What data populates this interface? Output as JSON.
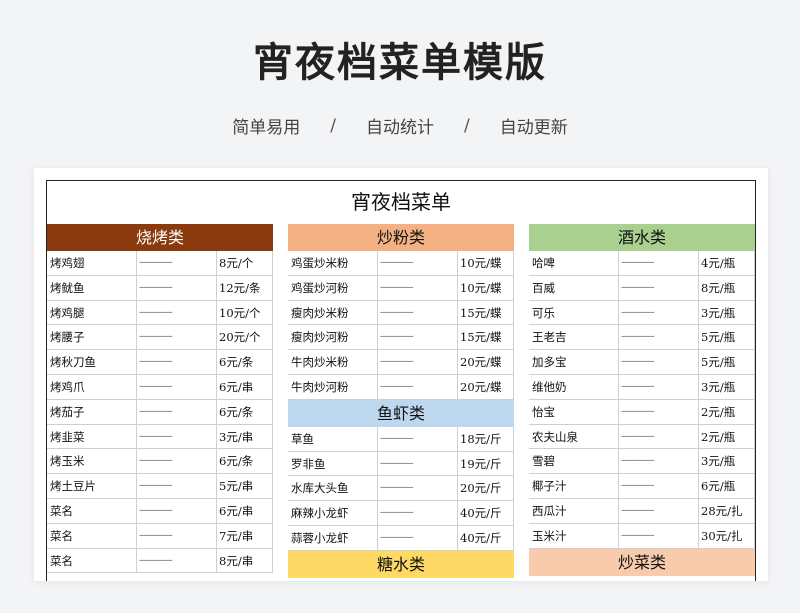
{
  "page": {
    "title": "宵夜档菜单模版",
    "tags": [
      "简单易用",
      "自动统计",
      "自动更新"
    ],
    "separator": "/"
  },
  "sheet": {
    "title": "宵夜档菜单",
    "dash": "----------------",
    "columns": [
      {
        "sections": [
          {
            "name": "烧烤类",
            "bg": "#8a3a0c",
            "color": "#ffffff",
            "items": [
              {
                "name": "烤鸡翅",
                "price": "8元/个"
              },
              {
                "name": "烤鱿鱼",
                "price": "12元/条"
              },
              {
                "name": "烤鸡腿",
                "price": "10元/个"
              },
              {
                "name": "烤腰子",
                "price": "20元/个"
              },
              {
                "name": "烤秋刀鱼",
                "price": "6元/条"
              },
              {
                "name": "烤鸡爪",
                "price": "6元/串"
              },
              {
                "name": "烤茄子",
                "price": "6元/条"
              },
              {
                "name": "烤韭菜",
                "price": "3元/串"
              },
              {
                "name": "烤玉米",
                "price": "6元/条"
              },
              {
                "name": "烤土豆片",
                "price": "5元/串"
              },
              {
                "name": "菜名",
                "price": "6元/串"
              },
              {
                "name": "菜名",
                "price": "7元/串"
              },
              {
                "name": "菜名",
                "price": "8元/串"
              }
            ]
          }
        ]
      },
      {
        "sections": [
          {
            "name": "炒粉类",
            "bg": "#f4b183",
            "color": "#111111",
            "items": [
              {
                "name": "鸡蛋炒米粉",
                "price": "10元/蝶"
              },
              {
                "name": "鸡蛋炒河粉",
                "price": "10元/蝶"
              },
              {
                "name": "瘦肉炒米粉",
                "price": "15元/蝶"
              },
              {
                "name": "瘦肉炒河粉",
                "price": "15元/蝶"
              },
              {
                "name": "牛肉炒米粉",
                "price": "20元/蝶"
              },
              {
                "name": "牛肉炒河粉",
                "price": "20元/蝶"
              }
            ]
          },
          {
            "name": "鱼虾类",
            "bg": "#bdd7ee",
            "color": "#111111",
            "items": [
              {
                "name": "草鱼",
                "price": "18元/斤"
              },
              {
                "name": "罗非鱼",
                "price": "19元/斤"
              },
              {
                "name": "水库大头鱼",
                "price": "20元/斤"
              },
              {
                "name": "麻辣小龙虾",
                "price": "40元/斤"
              },
              {
                "name": "蒜蓉小龙虾",
                "price": "40元/斤"
              }
            ]
          },
          {
            "name": "糖水类",
            "bg": "#ffd966",
            "color": "#111111",
            "items": []
          }
        ]
      },
      {
        "sections": [
          {
            "name": "酒水类",
            "bg": "#a9d08e",
            "color": "#111111",
            "items": [
              {
                "name": "哈啤",
                "price": "4元/瓶"
              },
              {
                "name": "百威",
                "price": "8元/瓶"
              },
              {
                "name": "可乐",
                "price": "3元/瓶"
              },
              {
                "name": "王老吉",
                "price": "5元/瓶"
              },
              {
                "name": "加多宝",
                "price": "5元/瓶"
              },
              {
                "name": "维他奶",
                "price": "3元/瓶"
              },
              {
                "name": "怡宝",
                "price": "2元/瓶"
              },
              {
                "name": "农夫山泉",
                "price": "2元/瓶"
              },
              {
                "name": "雪碧",
                "price": "3元/瓶"
              },
              {
                "name": "椰子汁",
                "price": "6元/瓶"
              },
              {
                "name": "西瓜汁",
                "price": "28元/扎"
              },
              {
                "name": "玉米汁",
                "price": "30元/扎"
              }
            ]
          },
          {
            "name": "炒菜类",
            "bg": "#f8cbad",
            "color": "#111111",
            "items": []
          }
        ]
      }
    ]
  }
}
